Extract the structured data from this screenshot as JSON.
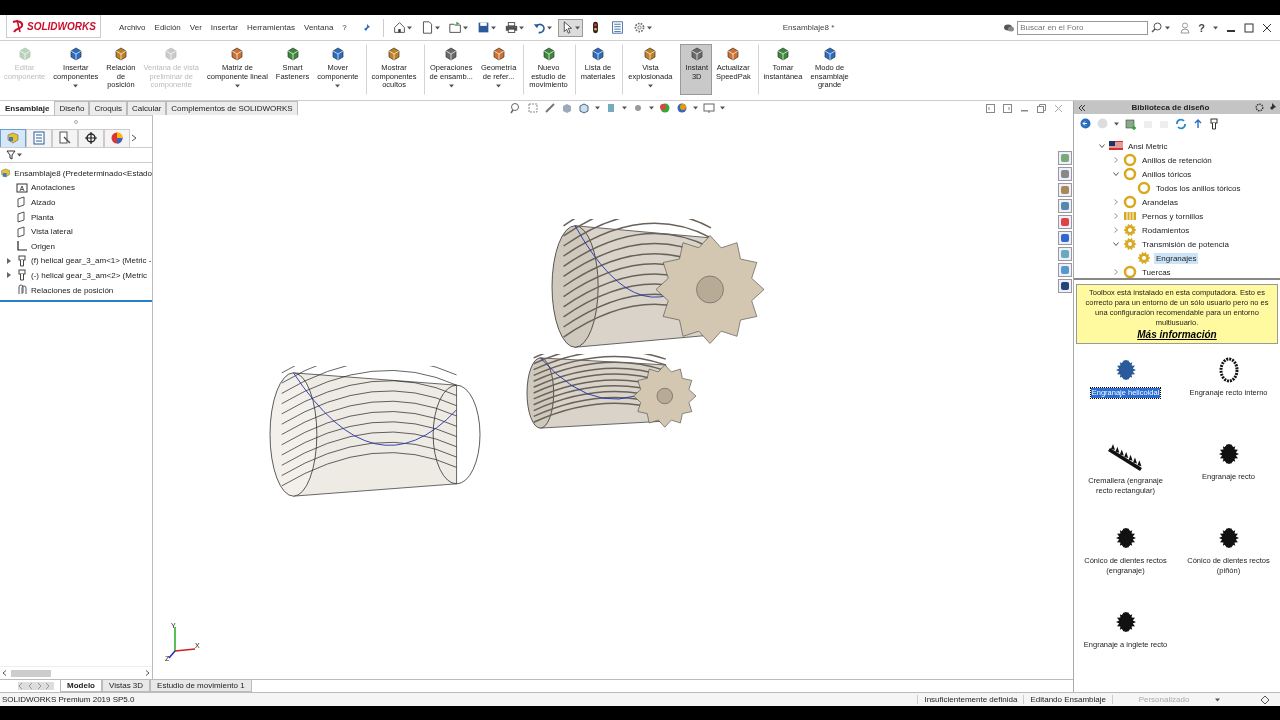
{
  "app": {
    "logo": "SOLIDWORKS",
    "menus": [
      "Archivo",
      "Edición",
      "Ver",
      "Insertar",
      "Herramientas",
      "Ventana",
      "?"
    ],
    "document_title": "Ensamblaje8 *",
    "search": {
      "placeholder": "Buscar en el Foro"
    },
    "help": "?"
  },
  "quick_access": [
    {
      "kind": "home",
      "selected": false
    },
    {
      "kind": "new",
      "selected": false
    },
    {
      "kind": "open",
      "selected": false
    },
    {
      "kind": "save",
      "selected": false
    },
    {
      "kind": "print",
      "selected": false
    },
    {
      "kind": "undo",
      "selected": false
    },
    {
      "kind": "select",
      "selected": true
    },
    {
      "kind": "light",
      "selected": false
    },
    {
      "kind": "list",
      "selected": false
    },
    {
      "kind": "gear",
      "selected": false
    }
  ],
  "ribbon": [
    {
      "label": "Editar\ncomponente",
      "disabled": true,
      "dropdown": false,
      "selected": false,
      "separator_before": false
    },
    {
      "label": "Insertar\ncomponentes",
      "disabled": false,
      "dropdown": true,
      "selected": false,
      "separator_before": false
    },
    {
      "label": "Relación\nde\nposición",
      "disabled": false,
      "dropdown": false,
      "selected": false,
      "separator_before": false
    },
    {
      "label": "Ventana de vista\npreliminar de\ncomponente",
      "disabled": true,
      "dropdown": false,
      "selected": false,
      "separator_before": false
    },
    {
      "label": "Matriz de\ncomponente lineal",
      "disabled": false,
      "dropdown": true,
      "selected": false,
      "separator_before": false
    },
    {
      "label": "Smart\nFasteners",
      "disabled": false,
      "dropdown": false,
      "selected": false,
      "separator_before": false
    },
    {
      "label": "Mover\ncomponente",
      "disabled": false,
      "dropdown": true,
      "selected": false,
      "separator_before": false
    },
    {
      "label": "Mostrar\ncomponentes\nocultos",
      "disabled": false,
      "dropdown": false,
      "selected": false,
      "separator_before": true
    },
    {
      "label": "Operaciones\nde ensamb...",
      "disabled": false,
      "dropdown": true,
      "selected": false,
      "separator_before": true
    },
    {
      "label": "Geometría\nde refer...",
      "disabled": false,
      "dropdown": true,
      "selected": false,
      "separator_before": false
    },
    {
      "label": "Nuevo\nestudio de\nmovimiento",
      "disabled": false,
      "dropdown": false,
      "selected": false,
      "separator_before": true
    },
    {
      "label": "Lista de\nmateriales",
      "disabled": false,
      "dropdown": false,
      "selected": false,
      "separator_before": true
    },
    {
      "label": "Vista\nexplosionada",
      "disabled": false,
      "dropdown": true,
      "selected": false,
      "separator_before": true
    },
    {
      "label": "Instant\n3D",
      "disabled": false,
      "dropdown": false,
      "selected": true,
      "separator_before": true
    },
    {
      "label": "Actualizar\nSpeedPak",
      "disabled": false,
      "dropdown": false,
      "selected": false,
      "separator_before": false
    },
    {
      "label": "Tomar\ninstantánea",
      "disabled": false,
      "dropdown": false,
      "selected": false,
      "separator_before": true
    },
    {
      "label": "Modo de\nensamblaje\ngrande",
      "disabled": false,
      "dropdown": false,
      "selected": false,
      "separator_before": false
    }
  ],
  "command_tabs": [
    {
      "label": "Ensamblaje",
      "selected": true
    },
    {
      "label": "Diseño",
      "selected": false
    },
    {
      "label": "Croquis",
      "selected": false
    },
    {
      "label": "Calcular",
      "selected": false
    },
    {
      "label": "Complementos de SOLIDWORKS",
      "selected": false
    }
  ],
  "feature_manager": {
    "tabs": [
      {
        "kind": "assembly",
        "selected": true
      },
      {
        "kind": "property",
        "selected": false
      },
      {
        "kind": "config",
        "selected": false
      },
      {
        "kind": "dimxpert",
        "selected": false
      },
      {
        "kind": "display",
        "selected": false
      }
    ],
    "root": "Ensamblaje8  (Predeterminado<Estado",
    "items": [
      {
        "label": "Anotaciones",
        "kind": "annotations"
      },
      {
        "label": "Alzado",
        "kind": "plane"
      },
      {
        "label": "Planta",
        "kind": "plane"
      },
      {
        "label": "Vista lateral",
        "kind": "plane"
      },
      {
        "label": "Origen",
        "kind": "origin"
      },
      {
        "label": "(f) helical gear_3_am<1> (Metric -",
        "kind": "part"
      },
      {
        "label": "(-) helical gear_3_am<2> (Metric",
        "kind": "part"
      },
      {
        "label": "Relaciones de posición",
        "kind": "mates"
      }
    ]
  },
  "triad": {
    "labels": [
      "Y",
      "X",
      "Z"
    ]
  },
  "view_tabs": [
    {
      "label": "Modelo",
      "selected": true
    },
    {
      "label": "Vistas 3D",
      "selected": false
    },
    {
      "label": "Estudio de movimiento 1",
      "selected": false
    }
  ],
  "design_library": {
    "title": "Biblioteca de diseño",
    "tree": [
      {
        "label": "Ansi Metric",
        "kind": "flag",
        "expanded": true,
        "children": [
          {
            "label": "Anillos de retención",
            "kind": "ring",
            "expanded": false,
            "selected": false
          },
          {
            "label": "Anillos tóricos",
            "kind": "ring",
            "expanded": true,
            "selected": false,
            "children": [
              {
                "label": "Todos los anillos tóricos",
                "kind": "ring",
                "selected": false
              }
            ]
          },
          {
            "label": "Arandelas",
            "kind": "ring",
            "expanded": false,
            "selected": false
          },
          {
            "label": "Pernos y tornillos",
            "kind": "bolt",
            "expanded": false,
            "selected": false
          },
          {
            "label": "Rodamientos",
            "kind": "gear",
            "expanded": false,
            "selected": false
          },
          {
            "label": "Transmisión de potencia",
            "kind": "gear",
            "expanded": true,
            "selected": false,
            "children": [
              {
                "label": "Engranajes",
                "kind": "gear",
                "selected": true
              }
            ]
          },
          {
            "label": "Tuercas",
            "kind": "ring",
            "expanded": false,
            "selected": false
          }
        ]
      }
    ],
    "notice": {
      "text": "Toolbox está instalado en esta computadora. Esto es correcto para un entorno de un sólo usuario pero no es una configuración recomendable para un entorno multiusuario.",
      "link": "Más información"
    },
    "items": [
      {
        "label": "Engranaje helicoidal",
        "kind": "helical",
        "selected": true
      },
      {
        "label": "Engranaje recto interno",
        "kind": "internal",
        "selected": false
      },
      {
        "label": "Cremallera (engranaje recto rectangular)",
        "kind": "rack",
        "selected": false
      },
      {
        "label": "Engranaje recto",
        "kind": "spur",
        "selected": false
      },
      {
        "label": "Cónico de dientes rectos (engranaje)",
        "kind": "bevel",
        "selected": false
      },
      {
        "label": "Cónico de dientes rectos (piñón)",
        "kind": "bevel",
        "selected": false
      },
      {
        "label": "Engranaje a inglete recto",
        "kind": "bevel",
        "selected": false
      }
    ]
  },
  "status_bar": {
    "product": "SOLIDWORKS Premium 2019 SP5.0",
    "fields": [
      {
        "label": "Insuficientemente definida",
        "disabled": false
      },
      {
        "label": "Editando Ensamblaje",
        "disabled": false
      },
      {
        "label": "Personalizado",
        "disabled": true
      }
    ]
  }
}
